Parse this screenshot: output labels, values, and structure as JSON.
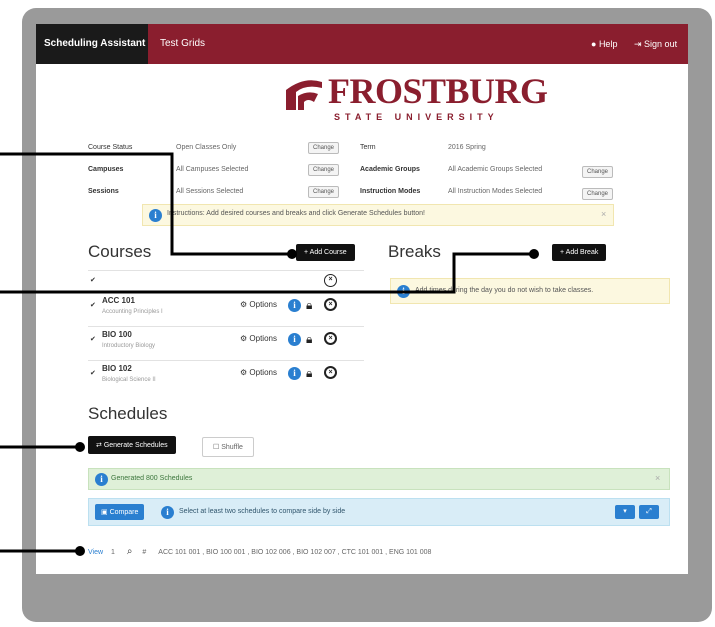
{
  "topbar": {
    "app_title": "Scheduling Assistant",
    "test_grid": "Test Grids",
    "help": "Help",
    "sign_out": "Sign out"
  },
  "logo": {
    "name": "FROSTBURG",
    "sub": "STATE UNIVERSITY"
  },
  "filters": {
    "course_status_label": "Course Status",
    "course_status_value": "Open Classes Only",
    "campuses_label": "Campuses",
    "campuses_value": "All Campuses Selected",
    "sessions_label": "Sessions",
    "sessions_value": "All Sessions Selected",
    "term_label": "Term",
    "term_value": "2016 Spring",
    "academic_groups_label": "Academic Groups",
    "academic_groups_value": "All Academic Groups Selected",
    "instruction_modes_label": "Instruction Modes",
    "instruction_modes_value": "All Instruction Modes Selected",
    "change_label": "Change"
  },
  "instructions": {
    "text": "Instructions: Add desired courses and breaks and click Generate Schedules button!"
  },
  "courses": {
    "heading": "Courses",
    "add_label": "+ Add Course",
    "options_label": "Options",
    "items": [
      {
        "code": "ACC 101",
        "name": "Accounting Principles I"
      },
      {
        "code": "BIO 100",
        "name": "Introductory Biology"
      },
      {
        "code": "BIO 102",
        "name": "Biological Science II"
      }
    ]
  },
  "breaks": {
    "heading": "Breaks",
    "add_label": "+ Add Break",
    "note": "Add times during the day you do not wish to take classes."
  },
  "schedules": {
    "heading": "Schedules",
    "generate_label": "Generate Schedules",
    "shuffle_label": "Shuffle",
    "generated_text": "Generated 800 Schedules",
    "compare_label": "Compare",
    "compare_text": "Select at least two schedules to compare side by side",
    "footer_view": "View",
    "footer_page": "1",
    "footer_list": "ACC 101 001 , BIO 100 001 , BIO 102 006 , BIO 102 007 , CTC 101 001 , ENG 101 008"
  },
  "colors": {
    "brand": "#8a1e2e",
    "info": "#2a7fd0",
    "frame": "#9a9a9a"
  }
}
